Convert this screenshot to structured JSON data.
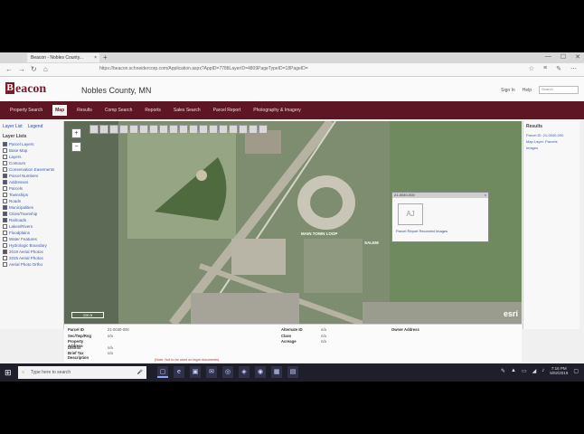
{
  "browser": {
    "tab_title": "Beacon - Nobles County...",
    "tab_close": "×",
    "new_tab": "+",
    "url": "https://beacon.schneidercorp.com/Application.aspx?AppID=7788LayerID=4809PageTypeID=18PageID=",
    "window_controls": [
      "—",
      "☐",
      "✕"
    ],
    "nav": [
      "←",
      "→",
      "↻",
      "⌂"
    ],
    "tools": [
      "☆",
      "≡",
      "✎",
      "⋯"
    ]
  },
  "site": {
    "logo_letter": "B",
    "logo_text": "eacon",
    "county": "Nobles County, MN",
    "header_links": [
      "Sign In",
      "Help"
    ],
    "search_placeholder": "Search"
  },
  "menu": {
    "items": [
      "Property Search",
      "Map",
      "Results",
      "Comp Search",
      "Reports",
      "Sales Search",
      "Parcel Report",
      "Photography & Imagery"
    ],
    "active_index": 1
  },
  "left_panel": {
    "tabs": [
      "Layer List",
      "Legend"
    ],
    "section_title": "Layer Lists",
    "items": [
      {
        "label": "Parcel Layers",
        "checked": true
      },
      {
        "label": "Base Map",
        "checked": false
      },
      {
        "label": "Layers",
        "checked": false
      },
      {
        "label": "Contours",
        "checked": false
      },
      {
        "label": "Conservation Easements",
        "checked": false
      },
      {
        "label": "Parcel Numbers",
        "checked": true
      },
      {
        "label": "Addresses",
        "checked": true
      },
      {
        "label": "Parcels",
        "checked": false
      },
      {
        "label": "Townships",
        "checked": false
      },
      {
        "label": "Roads",
        "checked": false
      },
      {
        "label": "Municipalities",
        "checked": true
      },
      {
        "label": "Cities/Township",
        "checked": true
      },
      {
        "label": "Railroads",
        "checked": true
      },
      {
        "label": "Lakes/Rivers",
        "checked": false
      },
      {
        "label": "Floodplains",
        "checked": false
      },
      {
        "label": "Water Features",
        "checked": false
      },
      {
        "label": "Hydrologic Boundary",
        "checked": false
      },
      {
        "label": "2019 Aerial Photos",
        "checked": true
      },
      {
        "label": "2015 Aerial Photos",
        "checked": false
      },
      {
        "label": "Aerial Photo Ortho",
        "checked": false
      }
    ]
  },
  "map": {
    "zoom_in": "+",
    "zoom_out": "−",
    "label_main": "MAIN TOWN LOOP",
    "label_side": "SALEM",
    "scale_text": "200 ft",
    "brand": "esri",
    "popup": {
      "title": "21-0040-000",
      "close": "×",
      "image_placeholder": "AJ",
      "link_text": "Parcel Report   Recorded Images"
    }
  },
  "right_panel": {
    "title": "Results",
    "lines": [
      "Parcel ID: 21-0040-000",
      "Map Layer: Parcels",
      "Images"
    ]
  },
  "info": {
    "rows": [
      {
        "k": "Parcel ID",
        "v": "21-0040-000"
      },
      {
        "k": "Sec/Twp/Rng",
        "v": "n/a"
      },
      {
        "k": "Property Address",
        "v": ""
      },
      {
        "k": "District",
        "v": "n/a"
      },
      {
        "k": "Brief Tax Description",
        "v": "n/a"
      }
    ],
    "rows2": [
      {
        "k": "Alternate ID",
        "v": "n/a"
      },
      {
        "k": "Class",
        "v": "n/a"
      },
      {
        "k": "Acreage",
        "v": "n/a"
      }
    ],
    "owner_label": "Owner Address",
    "note": "(Note: Not to be used on legal documents)"
  },
  "taskbar": {
    "start": "⊞",
    "search_placeholder": "Type here to search",
    "search_icon": "○",
    "mic": "🎤",
    "apps": [
      "▢",
      "e",
      "▣",
      "✉",
      "◎",
      "◈",
      "◉",
      "▦",
      "▤"
    ],
    "active_app_index": 0,
    "tray_icons": [
      "✎",
      "▲",
      "▭",
      "◢",
      "♪"
    ],
    "time": "7:16 PM",
    "date": "5/02/2019",
    "notif": "▢"
  }
}
